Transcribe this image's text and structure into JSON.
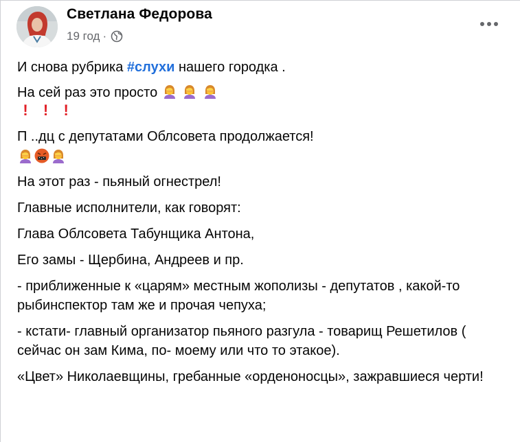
{
  "post": {
    "author": "Светлана Федорова",
    "time": "19 год",
    "separator": "·",
    "visibility_icon": "globe-icon",
    "more_icon": "more-horizontal-icon",
    "lines": {
      "l1_before": "И снова рубрика ",
      "hashtag": "#слухи",
      "l1_after": " нашего городка .",
      "l2": "На сей раз это просто ",
      "l3": "П ..дц с депутатами Облсовета продолжается!",
      "l4": "На этот раз - пьяный огнестрел!",
      "l5": "Главные исполнители, как говорят:",
      "l6": "Глава Облсовета Табунщика Антона,",
      "l7": "Его замы - Щербина, Андреев и пр.",
      "l8": "- приближенные к «царям» местным жополизы - депутатов , какой-то рыбинспектор там же и прочая чепуха;",
      "l9": "- кстати- главный организатор пьяного разгула - товарищ Решетилов ( сейчас он зам Кима, по- моему или что то этакое).",
      "l10": "«Цвет» Николаевщины, гребанные «орденоносцы», зажравшиеся черти!"
    },
    "emoji_row1": [
      "facepalm-woman-emoji",
      "facepalm-woman-emoji",
      "facepalm-woman-emoji"
    ],
    "bangs": [
      "!",
      "!",
      "!"
    ],
    "emoji_row2": [
      "facepalm-woman-emoji",
      "cursing-face-emoji",
      "facepalm-woman-emoji"
    ]
  }
}
